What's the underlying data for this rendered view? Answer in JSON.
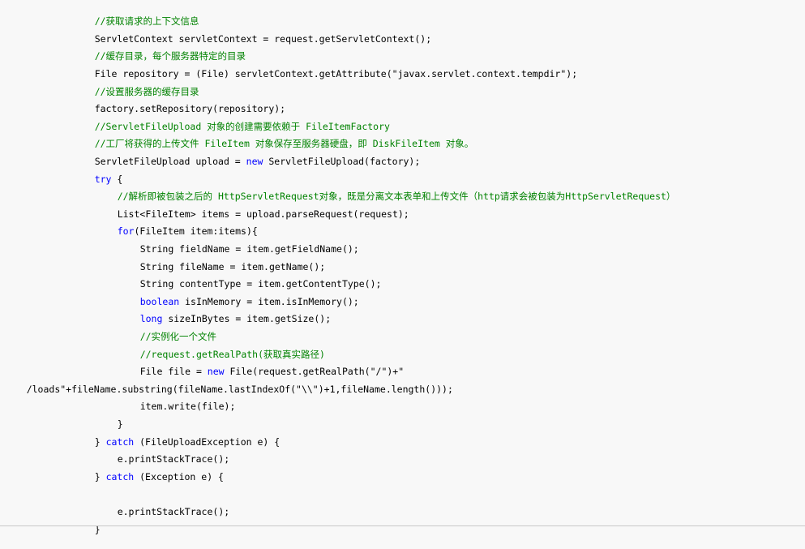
{
  "colors": {
    "background": "#f8f8f8",
    "comment": "#008200",
    "keyword": "#0000ff",
    "text": "#000000"
  },
  "code": {
    "l01": "//获取请求的上下文信息",
    "l02": "ServletContext servletContext = request.getServletContext();",
    "l03": "//缓存目录，每个服务器特定的目录",
    "l04": "File repository = (File) servletContext.getAttribute(\"javax.servlet.context.tempdir\");",
    "l05": "//设置服务器的缓存目录",
    "l06": "factory.setRepository(repository);",
    "l07": "//ServletFileUpload 对象的创建需要依赖于 FileItemFactory",
    "l08": "//工厂将获得的上传文件 FileItem 对象保存至服务器硬盘，即 DiskFileItem 对象。",
    "l09a": "ServletFileUpload upload = ",
    "l09b": "new",
    "l09c": " ServletFileUpload(factory);",
    "l10a": "try",
    "l10b": " {",
    "l11": "//解析即被包装之后的 HttpServletRequest对象，既是分离文本表单和上传文件（http请求会被包装为HttpServletRequest）",
    "l12": "List<FileItem> items = upload.parseRequest(request);",
    "l13a": "for",
    "l13b": "(FileItem item:items){",
    "l14": "String fieldName = item.getFieldName();",
    "l15": "String fileName = item.getName();",
    "l16": "String contentType = item.getContentType();",
    "l17a": "boolean",
    "l17b": " isInMemory = item.isInMemory();",
    "l18a": "long",
    "l18b": " sizeInBytes = item.getSize();",
    "l19": "//实例化一个文件",
    "l20": "//request.getRealPath(获取真实路径)",
    "l21a": "File file = ",
    "l21b": "new",
    "l21c": " File(request.getRealPath(\"/\")+\"",
    "l22": "/loads\"+fileName.substring(fileName.lastIndexOf(\"\\\\\")+1,fileName.length()));",
    "l23": "item.write(file);",
    "l24": "}",
    "l25a": "} ",
    "l25b": "catch",
    "l25c": " (FileUploadException e) {",
    "l26": "e.printStackTrace();",
    "l27a": "} ",
    "l27b": "catch",
    "l27c": " (Exception e) {",
    "l28": "e.printStackTrace();",
    "l29": "}"
  }
}
